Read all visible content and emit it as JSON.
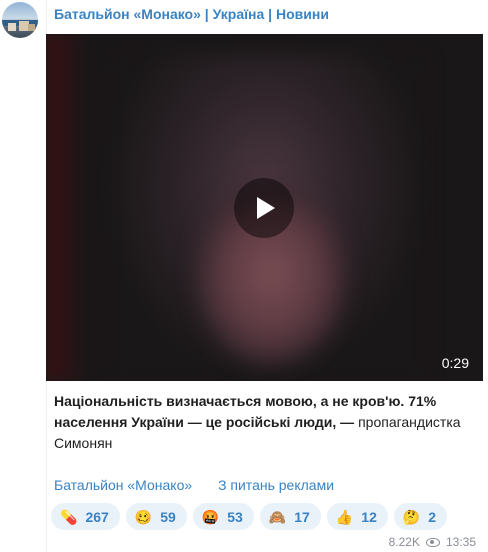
{
  "channel": {
    "title": "Батальйон «Монако» | Україна | Новини"
  },
  "video": {
    "duration": "0:29"
  },
  "message": {
    "quote_bold": "Національність визначається мовою, а не кров'ю. 71% населення України — це російські люди, —",
    "attribution": "пропагандистка Симонян"
  },
  "links": [
    "Батальйон «Монако»",
    "З питань реклами"
  ],
  "reactions": [
    {
      "emoji": "💊",
      "count": "267"
    },
    {
      "emoji": "🥴",
      "count": "59"
    },
    {
      "emoji": "🤬",
      "count": "53"
    },
    {
      "emoji": "🙈",
      "count": "17"
    },
    {
      "emoji": "👍",
      "count": "12"
    },
    {
      "emoji": "🤔",
      "count": "2"
    }
  ],
  "meta": {
    "views": "8.22K",
    "time": "13:35"
  },
  "colors": {
    "link": "#3a83c3",
    "reaction_bg": "#e9f1f9",
    "meta": "#8a8f96"
  }
}
